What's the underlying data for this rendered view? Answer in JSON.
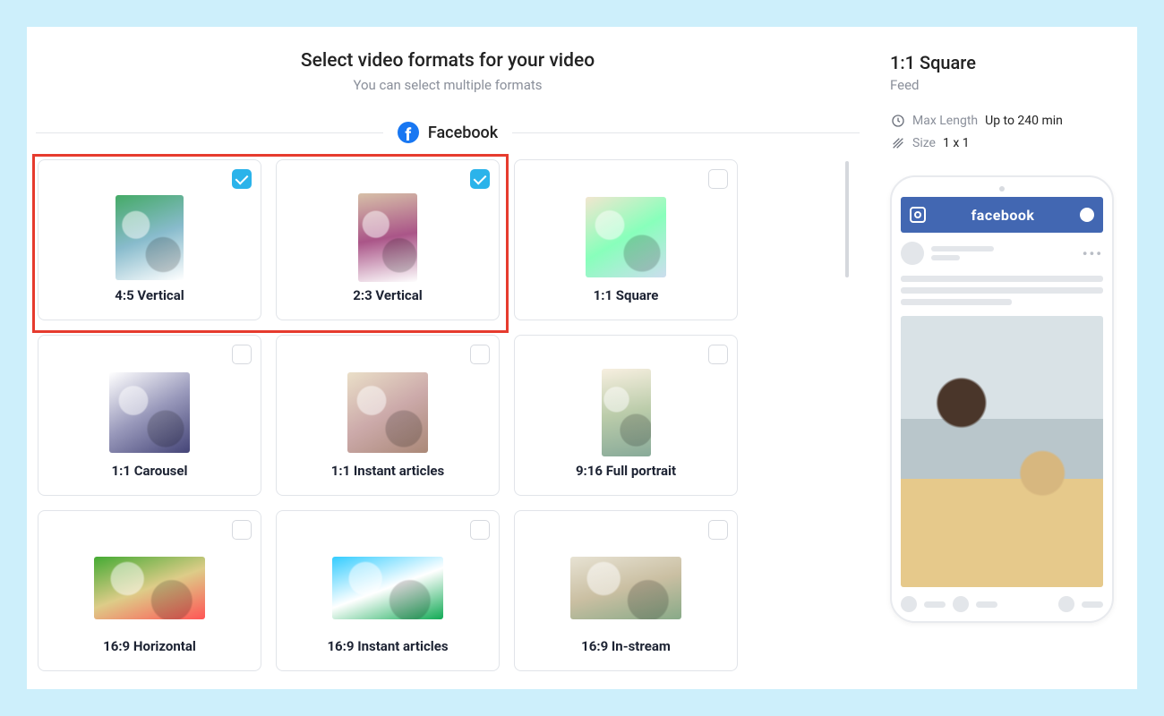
{
  "header": {
    "title": "Select video formats for your video",
    "subtitle": "You can select multiple formats"
  },
  "platform": {
    "name": "Facebook"
  },
  "formats": [
    {
      "label": "4:5 Vertical",
      "selected": true,
      "thumb": "ph-4x5"
    },
    {
      "label": "2:3 Vertical",
      "selected": true,
      "thumb": "ph-2x3"
    },
    {
      "label": "1:1 Square",
      "selected": false,
      "thumb": "ph-1x1"
    },
    {
      "label": "1:1 Carousel",
      "selected": false,
      "thumb": "ph-1x1b"
    },
    {
      "label": "1:1 Instant articles",
      "selected": false,
      "thumb": "ph-1x1c"
    },
    {
      "label": "9:16 Full portrait",
      "selected": false,
      "thumb": "ph-9x16"
    },
    {
      "label": "16:9 Horizontal",
      "selected": false,
      "thumb": "ph-16x9"
    },
    {
      "label": "16:9 Instant articles",
      "selected": false,
      "thumb": "ph-16x9b"
    },
    {
      "label": "16:9 In-stream",
      "selected": false,
      "thumb": "ph-16x9c"
    }
  ],
  "details": {
    "title": "1:1 Square",
    "placement": "Feed",
    "maxLengthLabel": "Max Length",
    "maxLengthValue": "Up to 240 min",
    "sizeLabel": "Size",
    "sizeValue": "1 x 1"
  },
  "phone": {
    "brand": "facebook"
  }
}
